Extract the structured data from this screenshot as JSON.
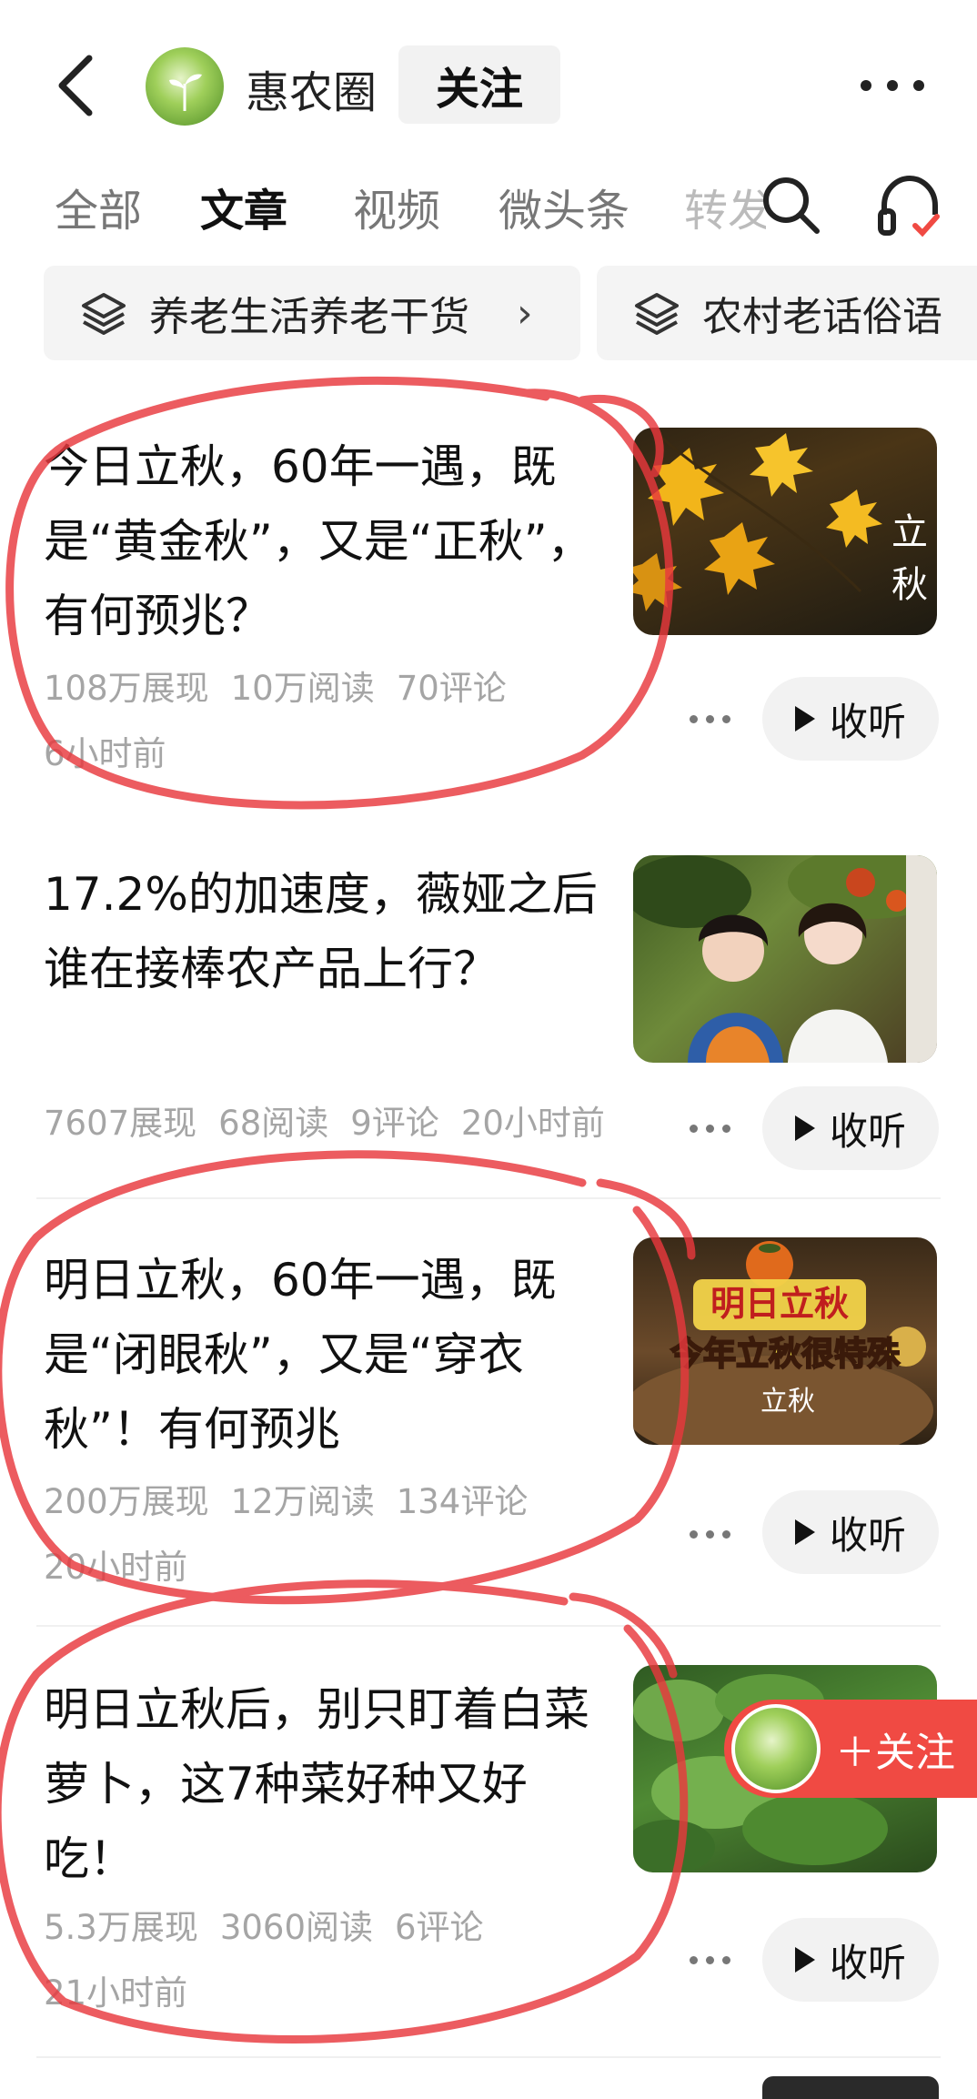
{
  "header": {
    "account_name": "惠农圈",
    "follow_label": "关注"
  },
  "tabs": [
    {
      "label": "全部",
      "active": false
    },
    {
      "label": "文章",
      "active": true
    },
    {
      "label": "视频",
      "active": false
    },
    {
      "label": "微头条",
      "active": false
    },
    {
      "label": "转发",
      "active": false
    }
  ],
  "collections": [
    {
      "label": "养老生活养老干货"
    },
    {
      "label": "农村老话俗语"
    }
  ],
  "articles": [
    {
      "title": "今日立秋，60年一遇，既是“黄金秋”，又是“正秋”，有何预兆？",
      "impressions": "108万展现",
      "reads": "10万阅读",
      "comments": "70评论",
      "time": "6小时前",
      "thumb_text": "立秋",
      "listen_label": "收听"
    },
    {
      "title": "17.2%的加速度，薇娅之后谁在接棒农产品上行？",
      "impressions": "7607展现",
      "reads": "68阅读",
      "comments": "9评论",
      "time": "20小时前",
      "listen_label": "收听"
    },
    {
      "title": "明日立秋，60年一遇，既是“闭眼秋”，又是“穿衣秋”！有何预兆",
      "impressions": "200万展现",
      "reads": "12万阅读",
      "comments": "134评论",
      "time": "20小时前",
      "thumb_text_1": "明日立秋",
      "thumb_text_2": "今年立秋很特殊",
      "thumb_text_3": "立秋",
      "listen_label": "收听"
    },
    {
      "title": "明日立秋后，别只盯着白菜萝卜，这7种菜好种又好吃！",
      "impressions": "5.3万展现",
      "reads": "3060阅读",
      "comments": "6评论",
      "time": "21小时前",
      "listen_label": "收听"
    }
  ],
  "floating_follow": {
    "label": "＋关注"
  },
  "colors": {
    "accent": "#f04a43",
    "annotation": "#e8383d",
    "meta": "#a5a5a5"
  }
}
